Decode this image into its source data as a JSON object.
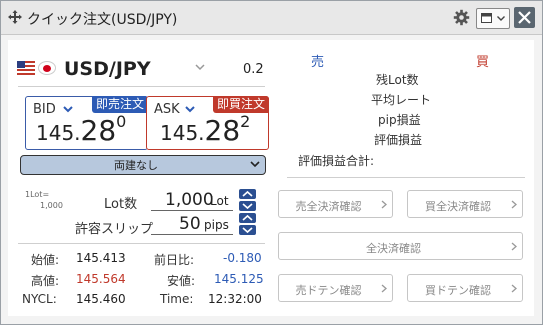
{
  "window": {
    "title": "クイック注文(USD/JPY)"
  },
  "pair": {
    "name": "USD/JPY",
    "spread": "0.2"
  },
  "bid": {
    "label": "BID",
    "button": "即売注文",
    "price_main": "145.",
    "price_big": "28",
    "price_sup": "0"
  },
  "ask": {
    "label": "ASK",
    "button": "即買注文",
    "price_main": "145.",
    "price_big": "28",
    "price_sup": "2"
  },
  "position_select": {
    "value": "両建なし"
  },
  "lot_note": {
    "line1": "1Lot=",
    "line2": "1,000"
  },
  "lot": {
    "label": "Lot数",
    "value": "1,000",
    "unit": "Lot"
  },
  "slippage": {
    "label": "許容スリップ",
    "value": "50",
    "unit": "pips"
  },
  "stats": {
    "open_label": "始値:",
    "open_value": "145.413",
    "prev_label": "前日比:",
    "prev_value": "-0.180",
    "high_label": "高値:",
    "high_value": "145.564",
    "low_label": "安値:",
    "low_value": "145.125",
    "nycl_label": "NYCL:",
    "nycl_value": "145.460",
    "time_label": "Time:",
    "time_value": "12:32:00"
  },
  "summary": {
    "sell_header": "売",
    "buy_header": "買",
    "rows": [
      "残Lot数",
      "平均レート",
      "pip損益",
      "評価損益"
    ],
    "total_label": "評価損益合計:"
  },
  "buttons": {
    "sell_all": "売全決済確認",
    "buy_all": "買全決済確認",
    "all": "全決済確認",
    "sell_doten": "売ドテン確認",
    "buy_doten": "買ドテン確認"
  },
  "colors": {
    "bid": "#2d5bb5",
    "ask": "#c0392b",
    "negative": "#2d5bb5",
    "high": "#c0392b",
    "low": "#2d5bb5"
  }
}
